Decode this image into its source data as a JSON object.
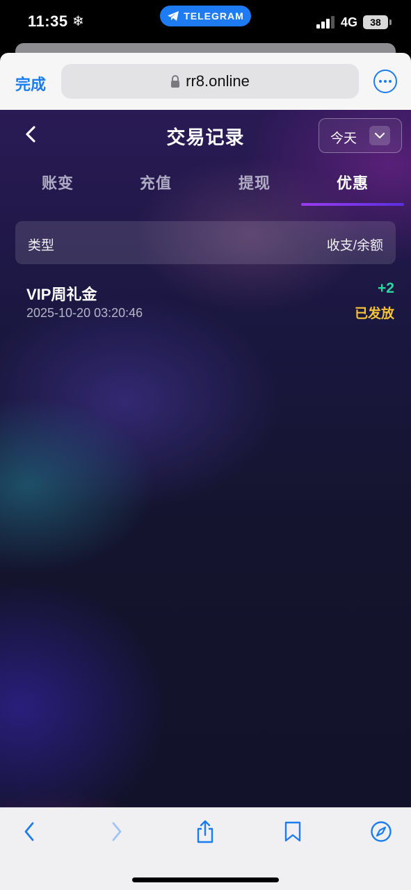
{
  "status_bar": {
    "time": "11:35",
    "telegram_label": "TELEGRAM",
    "network": "4G",
    "battery": "38"
  },
  "browser": {
    "done_label": "完成",
    "url": "rr8.online"
  },
  "header": {
    "title": "交易记录",
    "date_filter": "今天"
  },
  "tabs": [
    {
      "label": "账变",
      "active": false
    },
    {
      "label": "充值",
      "active": false
    },
    {
      "label": "提现",
      "active": false
    },
    {
      "label": "优惠",
      "active": true
    }
  ],
  "table": {
    "col_type": "类型",
    "col_amount": "收支/余额",
    "rows": [
      {
        "title": "VIP周礼金",
        "time": "2025-10-20 03:20:46",
        "amount": "+2",
        "status": "已发放"
      }
    ]
  },
  "colors": {
    "accent_blue": "#1a7cf0",
    "amount_green": "#2ed6a0",
    "status_yellow": "#f5c338",
    "tab_indicator": "#9a3cf0"
  }
}
